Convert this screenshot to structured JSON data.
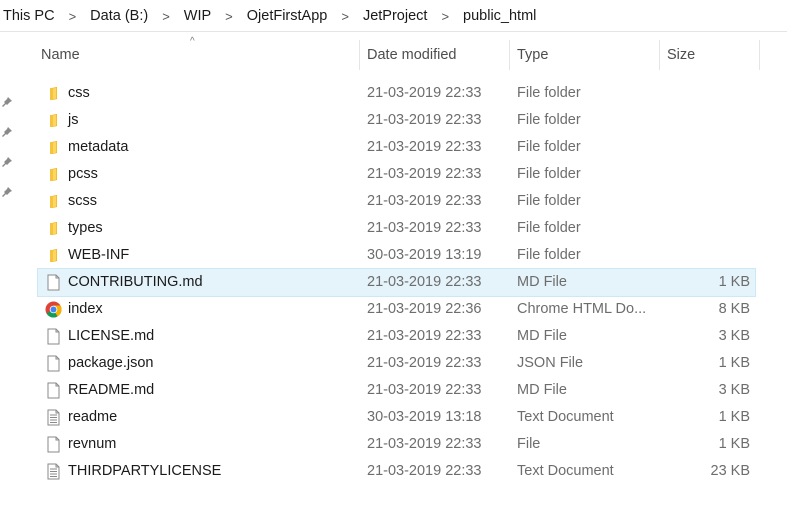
{
  "breadcrumb": {
    "items": [
      "This PC",
      "Data (B:)",
      "WIP",
      "OjetFirstApp",
      "JetProject",
      "public_html"
    ],
    "separator": ">"
  },
  "columns": {
    "name": "Name",
    "date": "Date modified",
    "type": "Type",
    "size": "Size",
    "sort_indicator": "^"
  },
  "files": [
    {
      "name": "css",
      "date": "21-03-2019 22:33",
      "type": "File folder",
      "size": "",
      "icon": "folder-icon"
    },
    {
      "name": "js",
      "date": "21-03-2019 22:33",
      "type": "File folder",
      "size": "",
      "icon": "folder-icon"
    },
    {
      "name": "metadata",
      "date": "21-03-2019 22:33",
      "type": "File folder",
      "size": "",
      "icon": "folder-icon"
    },
    {
      "name": "pcss",
      "date": "21-03-2019 22:33",
      "type": "File folder",
      "size": "",
      "icon": "folder-icon"
    },
    {
      "name": "scss",
      "date": "21-03-2019 22:33",
      "type": "File folder",
      "size": "",
      "icon": "folder-icon"
    },
    {
      "name": "types",
      "date": "21-03-2019 22:33",
      "type": "File folder",
      "size": "",
      "icon": "folder-icon"
    },
    {
      "name": "WEB-INF",
      "date": "30-03-2019 13:19",
      "type": "File folder",
      "size": "",
      "icon": "folder-icon"
    },
    {
      "name": "CONTRIBUTING.md",
      "date": "21-03-2019 22:33",
      "type": "MD File",
      "size": "1 KB",
      "icon": "file-icon",
      "selected": true
    },
    {
      "name": "index",
      "date": "21-03-2019 22:36",
      "type": "Chrome HTML Do...",
      "size": "8 KB",
      "icon": "chrome-icon"
    },
    {
      "name": "LICENSE.md",
      "date": "21-03-2019 22:33",
      "type": "MD File",
      "size": "3 KB",
      "icon": "file-icon"
    },
    {
      "name": "package.json",
      "date": "21-03-2019 22:33",
      "type": "JSON File",
      "size": "1 KB",
      "icon": "file-icon"
    },
    {
      "name": "README.md",
      "date": "21-03-2019 22:33",
      "type": "MD File",
      "size": "3 KB",
      "icon": "file-icon"
    },
    {
      "name": "readme",
      "date": "30-03-2019 13:18",
      "type": "Text Document",
      "size": "1 KB",
      "icon": "text-document-icon"
    },
    {
      "name": "revnum",
      "date": "21-03-2019 22:33",
      "type": "File",
      "size": "1 KB",
      "icon": "file-icon"
    },
    {
      "name": "THIRDPARTYLICENSE",
      "date": "21-03-2019 22:33",
      "type": "Text Document",
      "size": "23 KB",
      "icon": "text-document-icon"
    }
  ],
  "colors": {
    "selection_bg": "#e5f3fb",
    "folder_yellow": "#f5c342",
    "secondary_text": "#6d6d6d"
  }
}
